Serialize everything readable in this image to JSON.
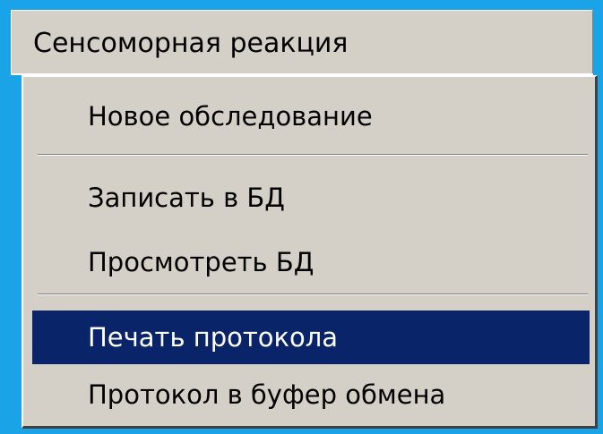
{
  "menubar": {
    "title": "Сенсоморная реакция"
  },
  "menu": {
    "items": [
      {
        "label": "Новое обследование",
        "highlighted": false
      },
      {
        "label": "Записать в БД",
        "highlighted": false
      },
      {
        "label": "Просмотреть БД",
        "highlighted": false
      },
      {
        "label": "Печать протокола",
        "highlighted": true
      },
      {
        "label": "Протокол в буфер обмена",
        "highlighted": false
      }
    ]
  },
  "colors": {
    "desktop": "#1aa3e6",
    "menu_face": "#d4d0c8",
    "highlight": "#0a246a",
    "highlight_text": "#ffffff"
  }
}
